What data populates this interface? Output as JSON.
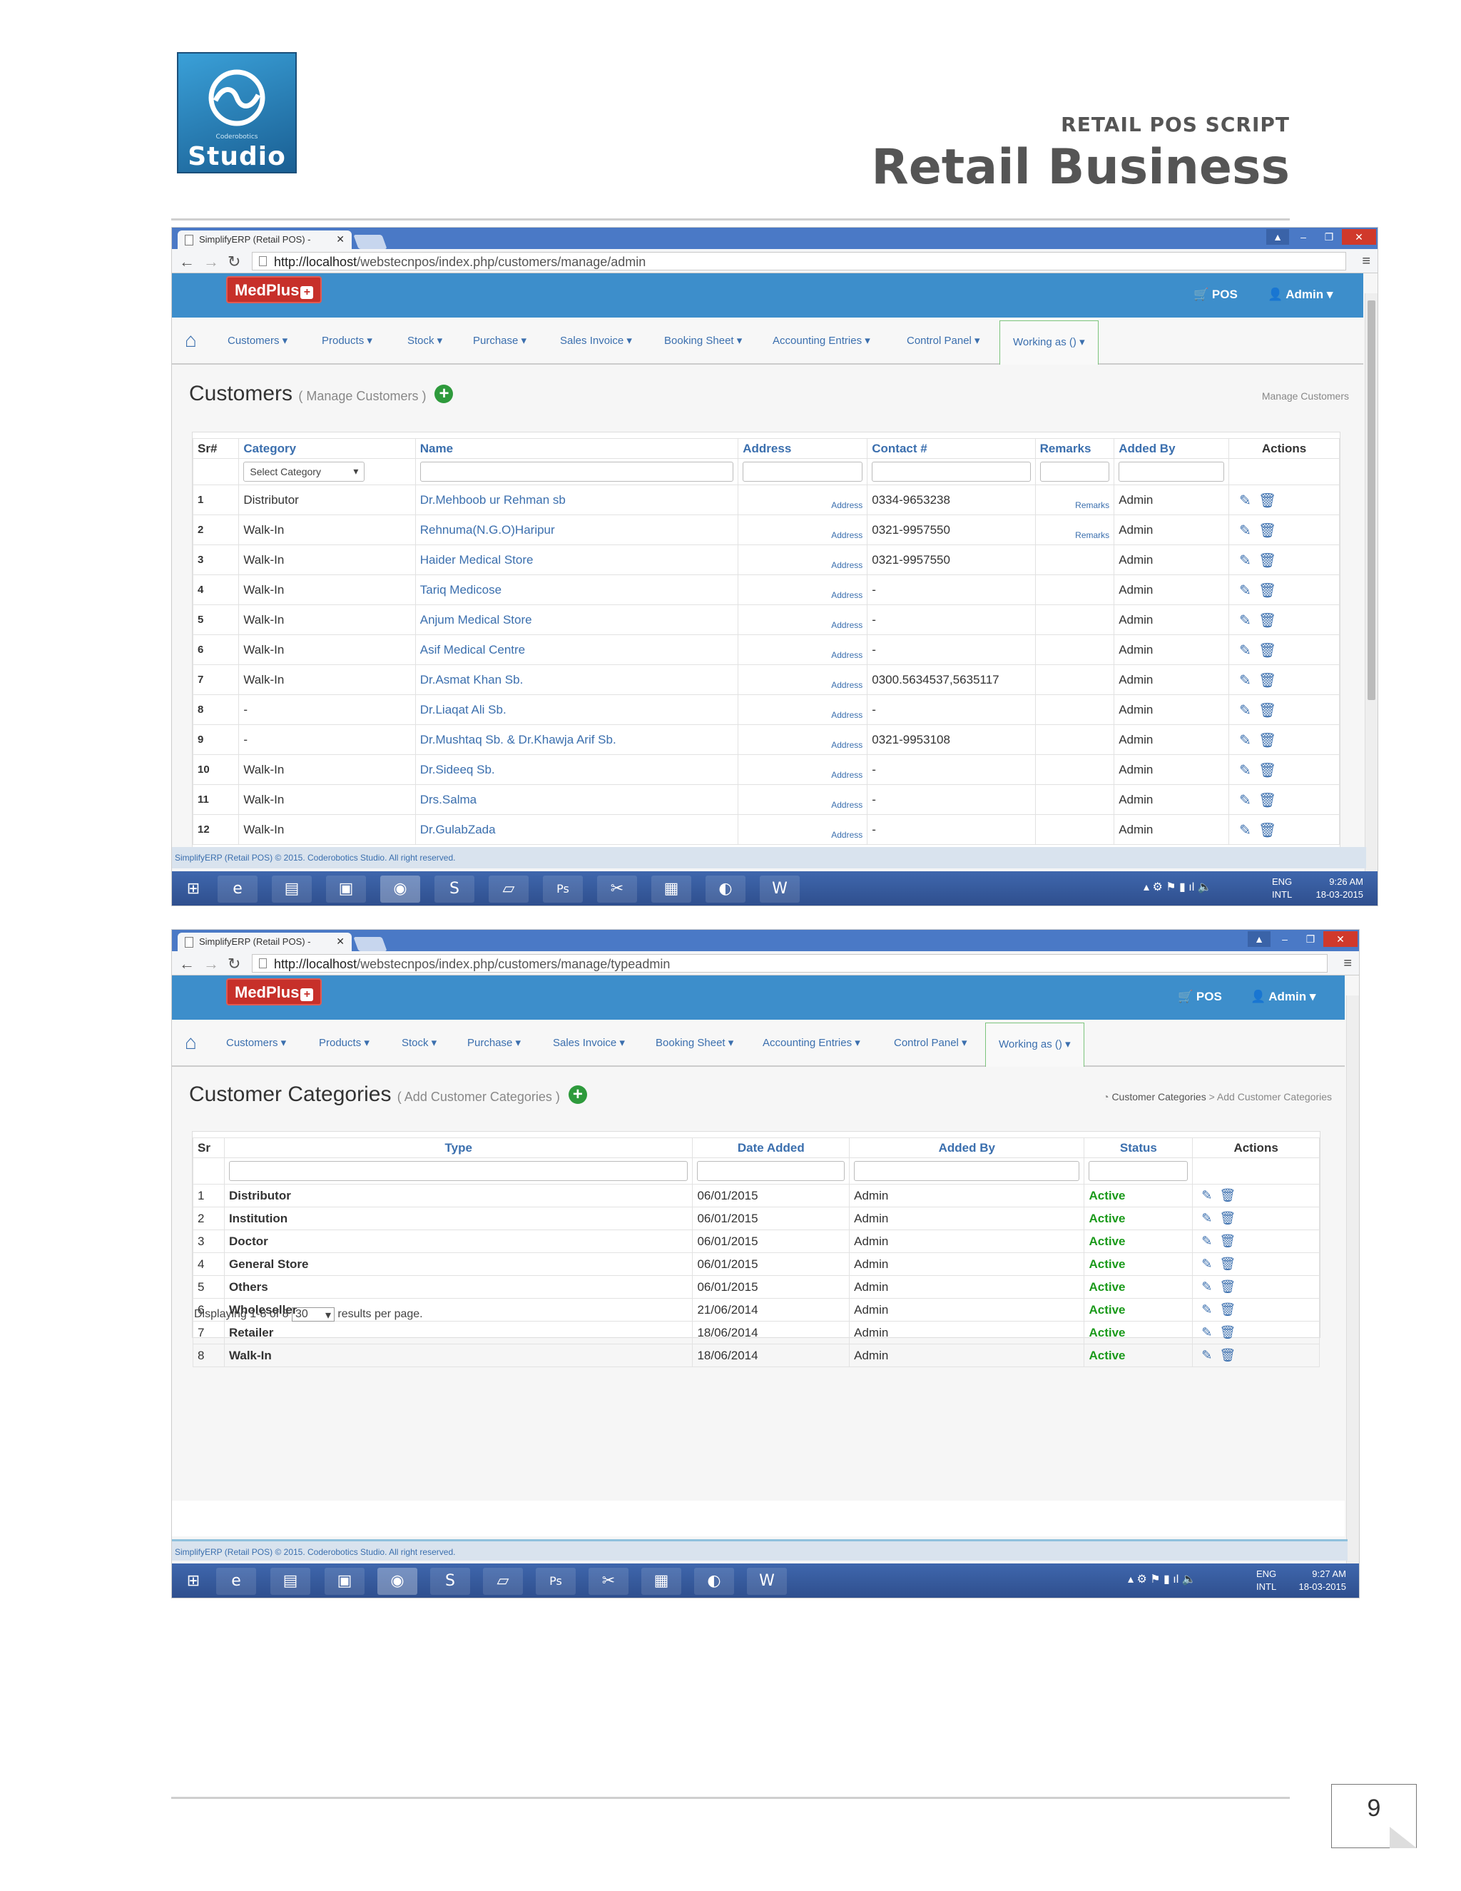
{
  "header": {
    "logo_sub": "Coderobotics",
    "logo_word": "Studio",
    "kicker": "RETAIL POS SCRIPT",
    "title": "Retail Business"
  },
  "page_number": "9",
  "shot1": {
    "tab_title": "SimplifyERP (Retail POS) -",
    "url_host": "http://localhost",
    "url_path": "/webstecnpos/index.php/customers/manage/admin",
    "brand": "MedPlus",
    "pos": "POS",
    "admin": "Admin",
    "menu": [
      "Customers ▾",
      "Products ▾",
      "Stock ▾",
      "Purchase ▾",
      "Sales Invoice ▾",
      "Booking Sheet ▾",
      "Accounting Entries ▾",
      "Control Panel ▾",
      "Working as () ▾"
    ],
    "title": "Customers",
    "subtitle": "( Manage Customers )",
    "crumb": "Manage Customers",
    "headers": [
      "Sr#",
      "Category",
      "Name",
      "Address",
      "Contact #",
      "Remarks",
      "Added By",
      "Actions"
    ],
    "filter_placeholder": "Select Category",
    "rows": [
      {
        "sr": "1",
        "cat": "Distributor",
        "name": "Dr.Mehboob ur Rehman sb",
        "addr": "Address",
        "contact": "0334-9653238",
        "remarks": "Remarks",
        "by": "Admin"
      },
      {
        "sr": "2",
        "cat": "Walk-In",
        "name": "Rehnuma(N.G.O)Haripur",
        "addr": "Address",
        "contact": "0321-9957550",
        "remarks": "Remarks",
        "by": "Admin"
      },
      {
        "sr": "3",
        "cat": "Walk-In",
        "name": "Haider Medical Store",
        "addr": "Address",
        "contact": "0321-9957550",
        "remarks": "",
        "by": "Admin"
      },
      {
        "sr": "4",
        "cat": "Walk-In",
        "name": "Tariq Medicose",
        "addr": "Address",
        "contact": "-",
        "remarks": "",
        "by": "Admin"
      },
      {
        "sr": "5",
        "cat": "Walk-In",
        "name": "Anjum Medical Store",
        "addr": "Address",
        "contact": "-",
        "remarks": "",
        "by": "Admin"
      },
      {
        "sr": "6",
        "cat": "Walk-In",
        "name": "Asif Medical Centre",
        "addr": "Address",
        "contact": "-",
        "remarks": "",
        "by": "Admin"
      },
      {
        "sr": "7",
        "cat": "Walk-In",
        "name": "Dr.Asmat Khan Sb.",
        "addr": "Address",
        "contact": "0300.5634537,5635117",
        "remarks": "",
        "by": "Admin"
      },
      {
        "sr": "8",
        "cat": "-",
        "name": "Dr.Liaqat Ali Sb.",
        "addr": "Address",
        "contact": "-",
        "remarks": "",
        "by": "Admin"
      },
      {
        "sr": "9",
        "cat": "-",
        "name": "Dr.Mushtaq Sb. & Dr.Khawja Arif Sb.",
        "addr": "Address",
        "contact": "0321-9953108",
        "remarks": "",
        "by": "Admin"
      },
      {
        "sr": "10",
        "cat": "Walk-In",
        "name": "Dr.Sideeq Sb.",
        "addr": "Address",
        "contact": "-",
        "remarks": "",
        "by": "Admin"
      },
      {
        "sr": "11",
        "cat": "Walk-In",
        "name": "Drs.Salma",
        "addr": "Address",
        "contact": "-",
        "remarks": "",
        "by": "Admin"
      },
      {
        "sr": "12",
        "cat": "Walk-In",
        "name": "Dr.GulabZada",
        "addr": "Address",
        "contact": "-",
        "remarks": "",
        "by": "Admin"
      }
    ],
    "footer": "SimplifyERP (Retail POS) © 2015. Coderobotics Studio. All right reserved.",
    "tray_lang": "ENG",
    "tray_kb": "INTL",
    "time": "9:26 AM",
    "date": "18-03-2015"
  },
  "shot2": {
    "tab_title": "SimplifyERP (Retail POS) -",
    "url_host": "http://localhost",
    "url_path": "/webstecnpos/index.php/customers/manage/typeadmin",
    "brand": "MedPlus",
    "pos": "POS",
    "admin": "Admin",
    "menu": [
      "Customers ▾",
      "Products ▾",
      "Stock ▾",
      "Purchase ▾",
      "Sales Invoice ▾",
      "Booking Sheet ▾",
      "Accounting Entries ▾",
      "Control Panel ▾",
      "Working as () ▾"
    ],
    "title": "Customer Categories",
    "subtitle": "( Add Customer Categories )",
    "crumb1": "Customer Categories",
    "crumb_sep": ">",
    "crumb2": "Add Customer Categories",
    "headers": [
      "Sr",
      "Type",
      "Date Added",
      "Added By",
      "Status",
      "Actions"
    ],
    "rows": [
      {
        "sr": "1",
        "type": "Distributor",
        "date": "06/01/2015",
        "by": "Admin",
        "status": "Active"
      },
      {
        "sr": "2",
        "type": "Institution",
        "date": "06/01/2015",
        "by": "Admin",
        "status": "Active"
      },
      {
        "sr": "3",
        "type": "Doctor",
        "date": "06/01/2015",
        "by": "Admin",
        "status": "Active"
      },
      {
        "sr": "4",
        "type": "General Store",
        "date": "06/01/2015",
        "by": "Admin",
        "status": "Active"
      },
      {
        "sr": "5",
        "type": "Others",
        "date": "06/01/2015",
        "by": "Admin",
        "status": "Active"
      },
      {
        "sr": "6",
        "type": "Wholeseller",
        "date": "21/06/2014",
        "by": "Admin",
        "status": "Active"
      },
      {
        "sr": "7",
        "type": "Retailer",
        "date": "18/06/2014",
        "by": "Admin",
        "status": "Active"
      },
      {
        "sr": "8",
        "type": "Walk-In",
        "date": "18/06/2014",
        "by": "Admin",
        "status": "Active"
      }
    ],
    "display_pre": "Displaying 1-8 of 8",
    "per_page": "30",
    "display_post": "results per page.",
    "footer": "SimplifyERP (Retail POS) © 2015. Coderobotics Studio. All right reserved.",
    "tray_lang": "ENG",
    "tray_kb": "INTL",
    "time": "9:27 AM",
    "date": "18-03-2015"
  },
  "colors": {
    "appbar": "#3d8ecb",
    "brand": "#c7302a",
    "link": "#3b6fae",
    "active": "#1b9a1b",
    "taskbar": "#2f4f8e"
  }
}
